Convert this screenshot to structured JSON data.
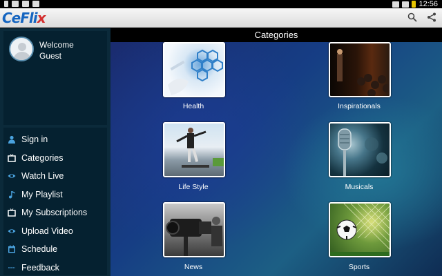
{
  "status_bar": {
    "time": "12:56"
  },
  "app": {
    "logo_prefix": "CeFli",
    "logo_accent": "x"
  },
  "sidebar": {
    "welcome_line1": "Welcome",
    "welcome_line2": "Guest",
    "items": [
      {
        "label": "Sign in",
        "icon": "person-icon"
      },
      {
        "label": "Categories",
        "icon": "tv-icon"
      },
      {
        "label": "Watch Live",
        "icon": "eye-icon"
      },
      {
        "label": "My Playlist",
        "icon": "music-note-icon"
      },
      {
        "label": "My Subscriptions",
        "icon": "tv-icon"
      },
      {
        "label": "Upload Video",
        "icon": "eye-icon"
      },
      {
        "label": "Schedule",
        "icon": "calendar-icon"
      },
      {
        "label": "Feedback",
        "icon": "dash-icon"
      }
    ]
  },
  "main": {
    "header": "Categories",
    "categories": [
      {
        "label": "Health"
      },
      {
        "label": "Inspirationals"
      },
      {
        "label": "Life Style"
      },
      {
        "label": "Musicals"
      },
      {
        "label": "News"
      },
      {
        "label": "Sports"
      }
    ]
  },
  "colors": {
    "logo_blue": "#1565c0",
    "logo_red": "#d32f2f",
    "sidebar_bg": "#052130",
    "header_bg": "#000000"
  }
}
